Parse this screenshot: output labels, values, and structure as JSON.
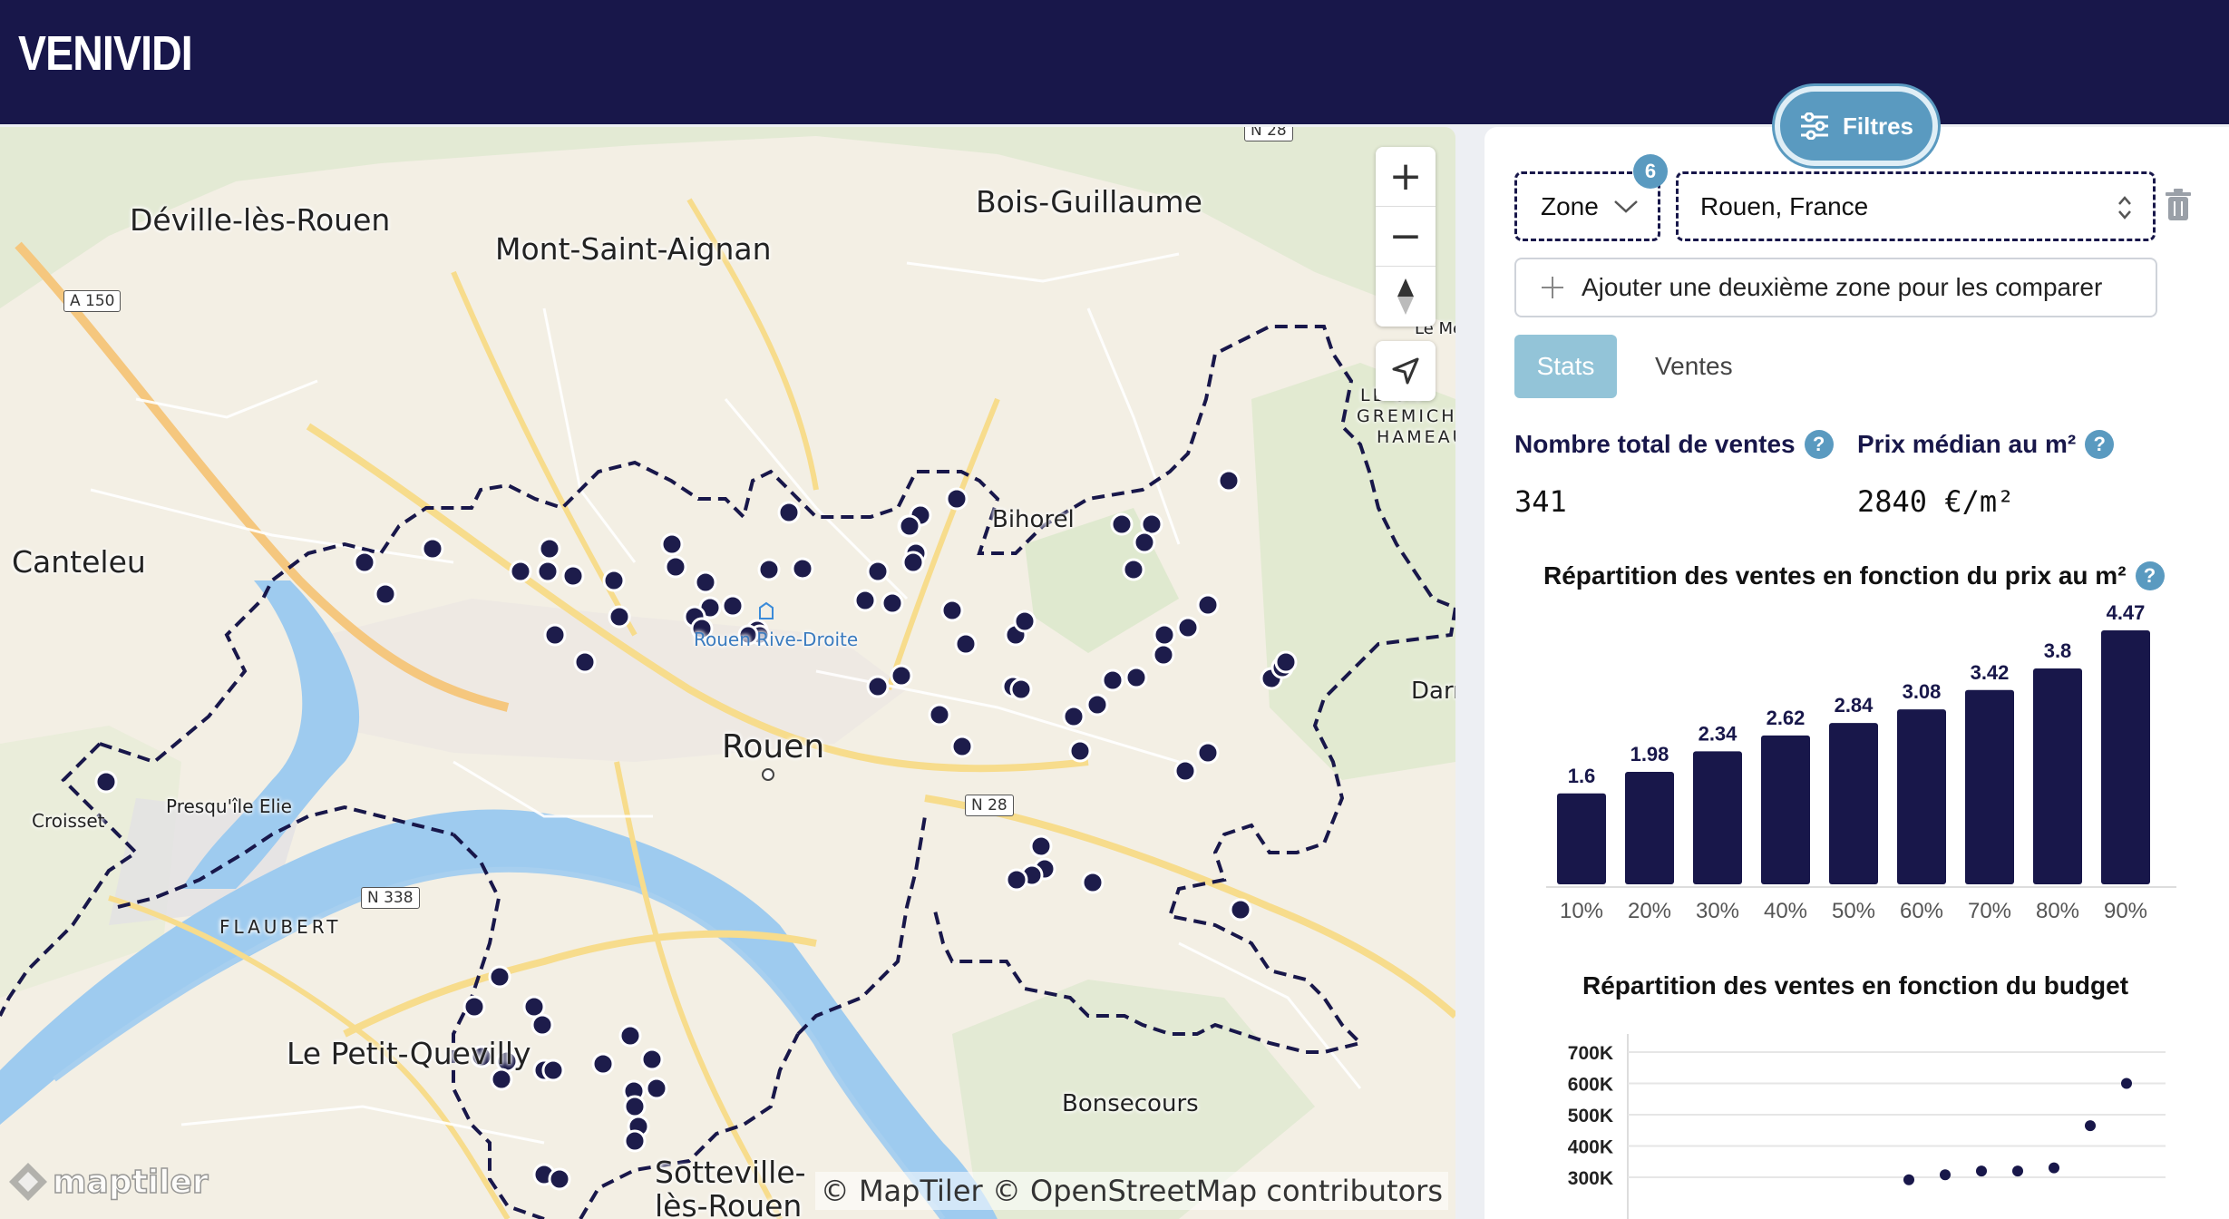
{
  "app": {
    "title": "VENIVIDI"
  },
  "map": {
    "labels": {
      "deville": "Déville-lès-Rouen",
      "mont_saint_aignan": "Mont-Saint-Aignan",
      "bois_guillaume": "Bois-Guillaume",
      "canteleu": "Canteleu",
      "bihorel": "Bihorel",
      "rouen": "Rouen",
      "rive_droite": "Rouen Rive-Droite",
      "croisset": "Croisset",
      "presquile": "Presqu'île Elie",
      "flaubert": "FLAUBERT",
      "le_petit_quevilly": "Le Petit-Quevilly",
      "bonsecours": "Bonsecours",
      "sotteville": "Sotteville-",
      "sotteville2": "lès-Rouen",
      "darn": "Darn",
      "le_mesnil": "Le Mesnil-",
      "gremichon": "GREMICH",
      "hameau": "HAMEAU",
      "lesn": "LE SN"
    },
    "roads": {
      "a150": "A 150",
      "n28_top": "N 28",
      "n28": "N 28",
      "n338": "N 338"
    },
    "controls": {
      "zoom_in": "+",
      "zoom_out": "−",
      "compass": "⬆",
      "locate": "➤"
    },
    "attribution": "© MapTiler © OpenStreetMap contributors",
    "logo": "maptiler"
  },
  "panel": {
    "filters_label": "Filtres",
    "zone_select": {
      "label": "Zone",
      "badge": "6"
    },
    "location": "Rouen, France",
    "add_zone": "Ajouter une deuxième zone pour les comparer",
    "tabs": {
      "stats": "Stats",
      "ventes": "Ventes"
    },
    "stats": {
      "total_label": "Nombre total de ventes",
      "total_value": "341",
      "median_label": "Prix médian au m²",
      "median_value": "2840 €/m²"
    },
    "help": "?",
    "chart_price_title": "Répartition des ventes en fonction du prix au m²",
    "chart_budget_title": "Répartition des ventes en fonction du budget"
  },
  "chart_data": [
    {
      "type": "bar",
      "title": "Répartition des ventes en fonction du prix au m²",
      "categories": [
        "10%",
        "20%",
        "30%",
        "40%",
        "50%",
        "60%",
        "70%",
        "80%",
        "90%"
      ],
      "values": [
        1.6,
        1.98,
        2.34,
        2.62,
        2.84,
        3.08,
        3.42,
        3.8,
        4.47
      ],
      "labels": [
        "1.6",
        "1.98",
        "2.34",
        "2.62",
        "2.84",
        "3.08",
        "3.42",
        "3.8",
        "4.47"
      ],
      "color": "#18174a",
      "grid": false
    },
    {
      "type": "scatter",
      "title": "Répartition des ventes en fonction du budget",
      "y_ticks": [
        "700K",
        "600K",
        "500K",
        "400K",
        "300K"
      ],
      "ylim": [
        300000,
        700000
      ],
      "points": [
        {
          "x": 1,
          "y": 292000
        },
        {
          "x": 2,
          "y": 308000
        },
        {
          "x": 3,
          "y": 320000
        },
        {
          "x": 4,
          "y": 320000
        },
        {
          "x": 5,
          "y": 330000
        },
        {
          "x": 6,
          "y": 465000
        },
        {
          "x": 7,
          "y": 600000
        }
      ],
      "color": "#18174a",
      "grid": true
    }
  ]
}
